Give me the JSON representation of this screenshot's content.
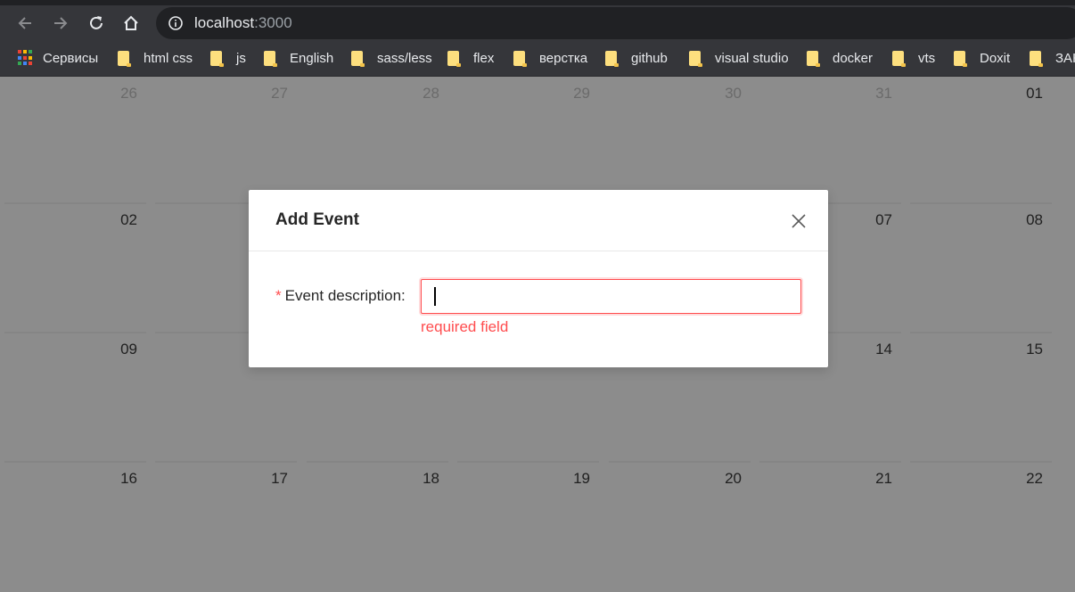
{
  "browser": {
    "url_host": "localhost",
    "url_port": ":3000"
  },
  "bookmarks": [
    {
      "label": "Сервисы",
      "icon": "apps-grid-icon"
    },
    {
      "label": "html css",
      "icon": "folder-icon"
    },
    {
      "label": "js",
      "icon": "folder-icon"
    },
    {
      "label": "English",
      "icon": "folder-icon"
    },
    {
      "label": "sass/less",
      "icon": "folder-icon"
    },
    {
      "label": "flex",
      "icon": "folder-icon"
    },
    {
      "label": "верстка",
      "icon": "folder-icon"
    },
    {
      "label": "github",
      "icon": "folder-icon"
    },
    {
      "label": "visual studio",
      "icon": "folder-icon"
    },
    {
      "label": "docker",
      "icon": "folder-icon"
    },
    {
      "label": "vts",
      "icon": "folder-icon"
    },
    {
      "label": "Doxit",
      "icon": "folder-icon"
    },
    {
      "label": "ЗАК",
      "icon": "folder-icon"
    }
  ],
  "calendar": {
    "weeks": [
      [
        "26",
        "27",
        "28",
        "29",
        "30",
        "31",
        "01"
      ],
      [
        "02",
        "",
        "",
        "",
        "",
        "07",
        "08"
      ],
      [
        "09",
        "",
        "",
        "",
        "",
        "14",
        "15"
      ],
      [
        "16",
        "17",
        "18",
        "19",
        "20",
        "21",
        "22"
      ]
    ],
    "muted_row_0": [
      true,
      true,
      true,
      true,
      true,
      true,
      false
    ]
  },
  "modal": {
    "title": "Add Event",
    "field_label": "Event description",
    "field_label_suffix": ":",
    "required_mark": "*",
    "input_value": "",
    "error": "required field"
  },
  "colors": {
    "error": "#ff4d4f",
    "chrome_bg": "#35363a",
    "overlay_bg": "#8c8c8c",
    "folder": "#fddf7e"
  }
}
